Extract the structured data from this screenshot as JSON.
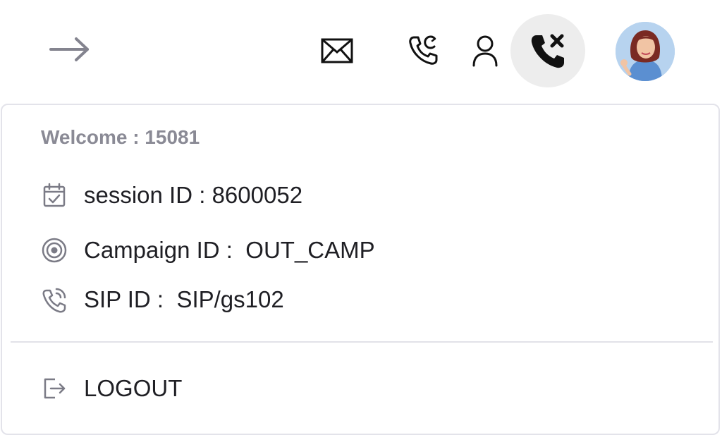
{
  "header": {
    "icons": {
      "back": "arrow-right-icon",
      "mail": "mail-icon",
      "callback": "phone-callback-icon",
      "user": "user-icon",
      "hangup": "phone-missed-icon",
      "avatar": "avatar"
    },
    "hangup_bg": "#ededed"
  },
  "menu": {
    "welcome": "Welcome : 15081",
    "items": [
      {
        "label": "session ID",
        "sep": " : ",
        "value": "8600052",
        "icon": "calendar-check-icon"
      },
      {
        "label": "Campaign ID",
        "sep": " :  ",
        "value": "OUT_CAMP",
        "icon": "target-icon"
      },
      {
        "label": "SIP ID",
        "sep": " :  ",
        "value": "SIP/gs102",
        "icon": "phone-ringing-icon"
      }
    ],
    "logout": {
      "label": "LOGOUT",
      "icon": "logout-icon"
    }
  },
  "colors": {
    "muted_text": "#8a8a95",
    "text": "#1f1f24",
    "border": "#e3e3ea",
    "icon_gray": "#7b7b86"
  }
}
